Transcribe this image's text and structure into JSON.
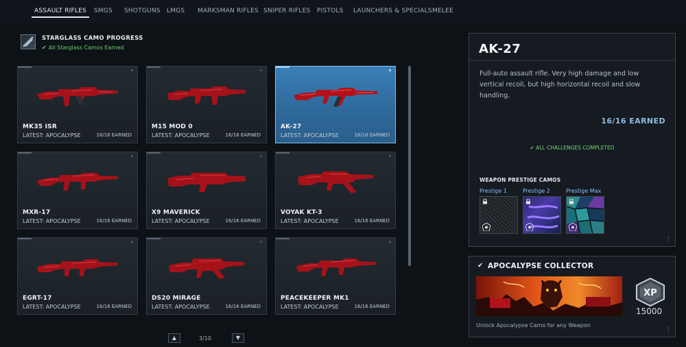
{
  "tabs": [
    {
      "label": "ASSAULT RIFLES",
      "active": true
    },
    {
      "label": "SMGS"
    },
    {
      "label": "SHOTGUNS"
    },
    {
      "label": "LMGS"
    },
    {
      "label": "MARKSMAN RIFLES"
    },
    {
      "label": "SNIPER RIFLES"
    },
    {
      "label": "PISTOLS"
    },
    {
      "label": "LAUNCHERS & SPECIALS"
    },
    {
      "label": "MELEE"
    }
  ],
  "progress": {
    "title": "STARGLASS CAMO PROGRESS",
    "status": "All Starglass Camos Earned",
    "check": "✔"
  },
  "weapons": [
    {
      "name": "MK35 ISR",
      "latest": "LATEST: APOCALYPSE",
      "earned": "16/16 EARNED"
    },
    {
      "name": "M15 MOD 0",
      "latest": "LATEST: APOCALYPSE",
      "earned": "16/16 EARNED"
    },
    {
      "name": "AK-27",
      "latest": "LATEST: APOCALYPSE",
      "earned": "16/16 EARNED",
      "selected": true
    },
    {
      "name": "MXR-17",
      "latest": "LATEST: APOCALYPSE",
      "earned": "16/16 EARNED"
    },
    {
      "name": "X9 MAVERICK",
      "latest": "LATEST: APOCALYPSE",
      "earned": "16/16 EARNED"
    },
    {
      "name": "VOYAK KT-3",
      "latest": "LATEST: APOCALYPSE",
      "earned": "16/16 EARNED"
    },
    {
      "name": "EGRT-17",
      "latest": "LATEST: APOCALYPSE",
      "earned": "16/16 EARNED"
    },
    {
      "name": "DS20 MIRAGE",
      "latest": "LATEST: APOCALYPSE",
      "earned": "16/16 EARNED"
    },
    {
      "name": "PEACEKEEPER MK1",
      "latest": "LATEST: APOCALYPSE",
      "earned": "16/16 EARNED"
    }
  ],
  "pager": {
    "text": "3/10",
    "up": "▲",
    "down": "▼"
  },
  "detail": {
    "title": "AK-27",
    "description": "Full-auto assault rifle. Very high damage and low vertical recoil, but high horizontal recoil and slow handling.",
    "count": "16/16 EARNED",
    "all_challenges": "✔ ALL CHALLENGES COMPLETED",
    "prestige_title": "WEAPON PRESTIGE CAMOS",
    "prestige": [
      {
        "label": "Prestige 1"
      },
      {
        "label": "Prestige 2"
      },
      {
        "label": "Prestige Max"
      }
    ]
  },
  "challenge": {
    "title": "APOCALYPSE COLLECTOR",
    "check": "✔",
    "xp_badge": "XP",
    "xp_value": "15000",
    "description": "Unlock Apocalypse Camo for any Weapon"
  },
  "colors": {
    "accent_blue": "#3a7fb6",
    "success_green": "#6ed16a",
    "camo_red": "#b3121b"
  }
}
